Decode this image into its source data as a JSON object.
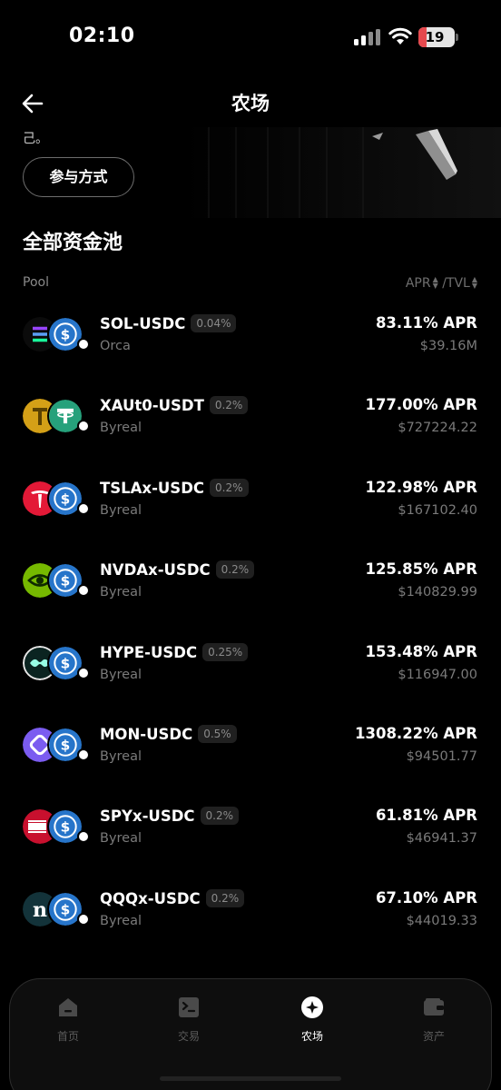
{
  "status": {
    "time": "02:10",
    "battery": "19"
  },
  "header": {
    "title": "农场"
  },
  "banner": {
    "text_fragment": "己。",
    "participate_label": "参与方式"
  },
  "section": {
    "title": "全部资金池"
  },
  "columns": {
    "pool": "Pool",
    "apr": "APR",
    "tvl": "/TVL"
  },
  "pools": [
    {
      "name": "SOL-USDC",
      "fee": "0.04%",
      "source": "Orca",
      "apr": "83.11% APR",
      "tvl": "$39.16M",
      "token1": "solana-icon",
      "token2": "usdc-icon",
      "color1": "#0b0b0b"
    },
    {
      "name": "XAUt0-USDT",
      "fee": "0.2%",
      "source": "Byreal",
      "apr": "177.00% APR",
      "tvl": "$727224.22",
      "token1": "tether-gold-icon",
      "token2": "usdt-icon",
      "color1": "#d4a017"
    },
    {
      "name": "TSLAx-USDC",
      "fee": "0.2%",
      "source": "Byreal",
      "apr": "122.98% APR",
      "tvl": "$167102.40",
      "token1": "tesla-icon",
      "token2": "usdc-icon",
      "color1": "#e31937"
    },
    {
      "name": "NVDAx-USDC",
      "fee": "0.2%",
      "source": "Byreal",
      "apr": "125.85% APR",
      "tvl": "$140829.99",
      "token1": "nvidia-icon",
      "token2": "usdc-icon",
      "color1": "#76b900"
    },
    {
      "name": "HYPE-USDC",
      "fee": "0.25%",
      "source": "Byreal",
      "apr": "153.48% APR",
      "tvl": "$116947.00",
      "token1": "hyperliquid-icon",
      "token2": "usdc-icon",
      "color1": "#0b2421"
    },
    {
      "name": "MON-USDC",
      "fee": "0.5%",
      "source": "Byreal",
      "apr": "1308.22% APR",
      "tvl": "$94501.77",
      "token1": "monad-icon",
      "token2": "usdc-icon",
      "color1": "#7b5cf0"
    },
    {
      "name": "SPYx-USDC",
      "fee": "0.2%",
      "source": "Byreal",
      "apr": "61.81% APR",
      "tvl": "$46941.37",
      "token1": "spy-icon",
      "token2": "usdc-icon",
      "color1": "#c8102e"
    },
    {
      "name": "QQQx-USDC",
      "fee": "0.2%",
      "source": "Byreal",
      "apr": "67.10% APR",
      "tvl": "$44019.33",
      "token1": "qqq-icon",
      "token2": "usdc-icon",
      "color1": "#13333a"
    }
  ],
  "nav": [
    {
      "label": "首页",
      "icon": "home-icon"
    },
    {
      "label": "交易",
      "icon": "trade-icon"
    },
    {
      "label": "农场",
      "icon": "farm-icon",
      "active": true
    },
    {
      "label": "资产",
      "icon": "wallet-icon"
    }
  ]
}
